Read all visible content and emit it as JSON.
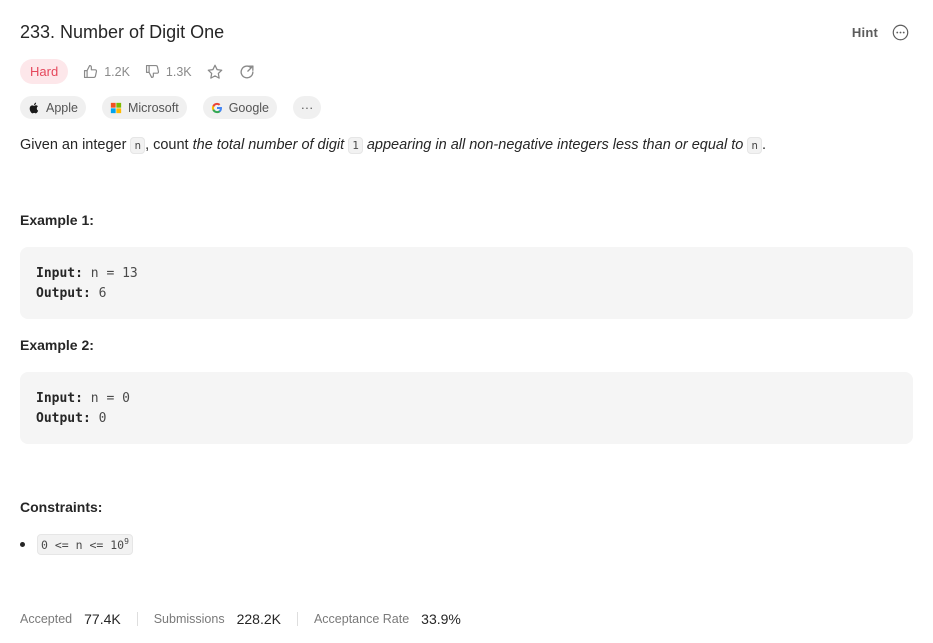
{
  "problem": {
    "title": "233. Number of Digit One",
    "hint_label": "Hint",
    "difficulty": "Hard",
    "likes": "1.2K",
    "dislikes": "1.3K"
  },
  "companies": [
    {
      "name": "Apple",
      "icon": "apple-icon"
    },
    {
      "name": "Microsoft",
      "icon": "microsoft-icon"
    },
    {
      "name": "Google",
      "icon": "google-icon"
    }
  ],
  "more_label": "···",
  "description": {
    "part1": "Given an integer ",
    "code_n": "n",
    "part2": ", count ",
    "italic1": "the total number of digit ",
    "code_1": "1",
    "italic2": " appearing in all non-negative integers less than or equal to ",
    "code_n2": "n",
    "part3": "."
  },
  "examples": [
    {
      "title": "Example 1:",
      "input_label": "Input:",
      "input": "n = 13",
      "output_label": "Output:",
      "output": "6"
    },
    {
      "title": "Example 2:",
      "input_label": "Input:",
      "input": "n = 0",
      "output_label": "Output:",
      "output": "0"
    }
  ],
  "constraints": {
    "title": "Constraints:",
    "item_base": "0 <= n <= 10",
    "item_exp": "9"
  },
  "stats": {
    "accepted_label": "Accepted",
    "accepted_value": "77.4K",
    "submissions_label": "Submissions",
    "submissions_value": "228.2K",
    "rate_label": "Acceptance Rate",
    "rate_value": "33.9%"
  },
  "colors": {
    "hard_bg": "#fde7ea",
    "hard_text": "#e5485c"
  }
}
